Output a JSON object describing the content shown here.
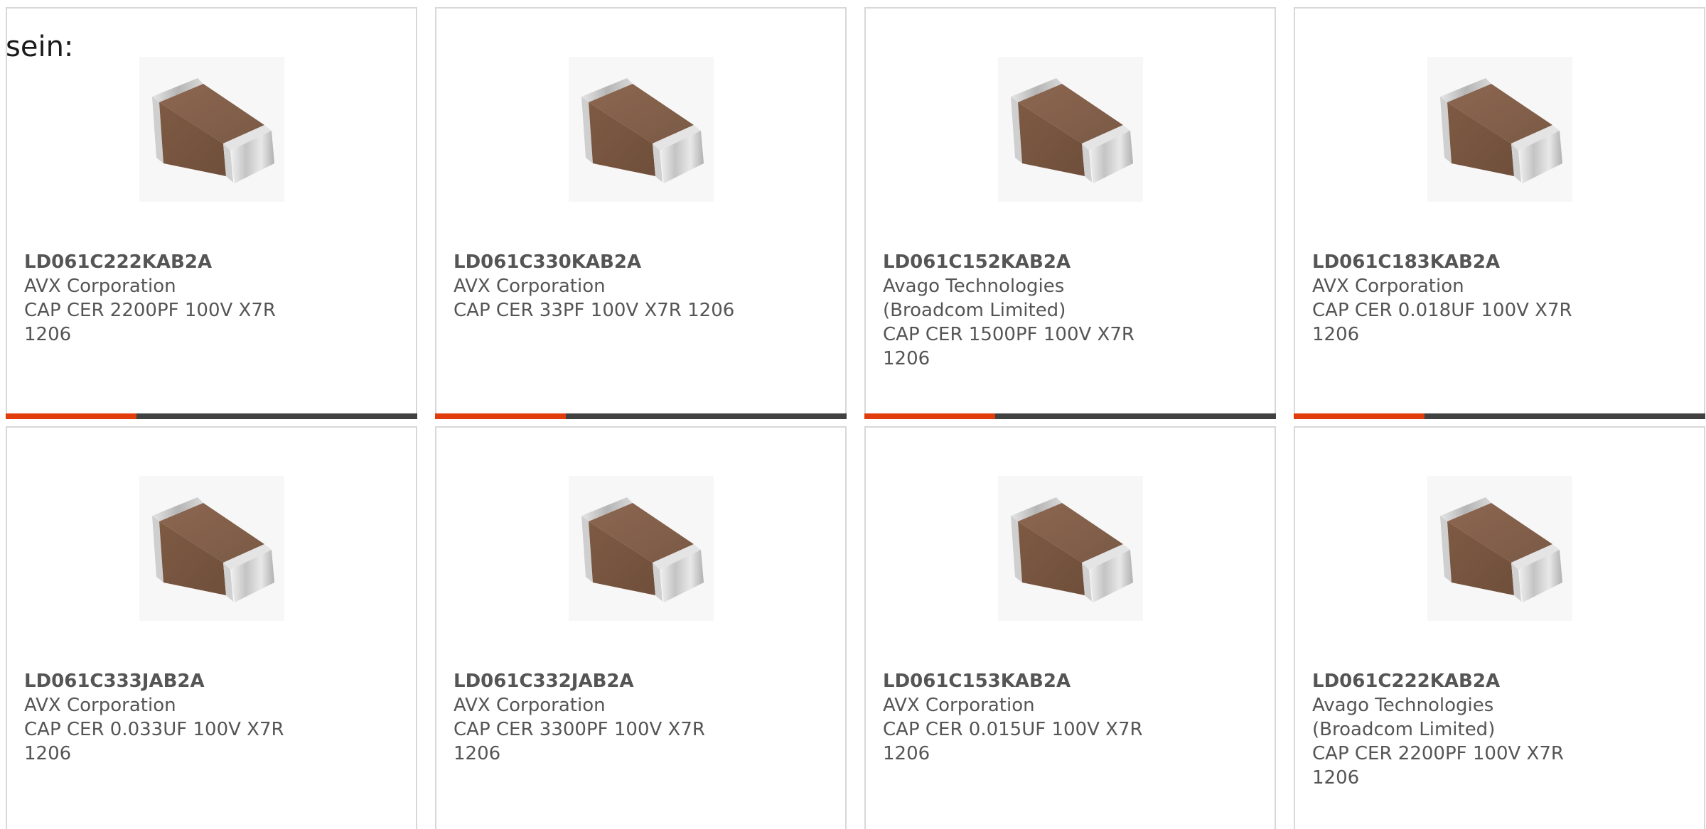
{
  "intro_text": "sein:",
  "colors": {
    "accent_bar": "#e03c0c",
    "dark_bar": "#414141",
    "text": "#555555",
    "card_border": "#d8d8d8"
  },
  "thumbnail_icon": "ceramic-capacitor-chip-icon",
  "products": [
    {
      "part_number": "LD061C222KAB2A",
      "manufacturer": "AVX Corporation",
      "description": "CAP CER 2200PF 100V X7R 1206"
    },
    {
      "part_number": "LD061C330KAB2A",
      "manufacturer": "AVX Corporation",
      "description": "CAP CER 33PF 100V X7R 1206"
    },
    {
      "part_number": "LD061C152KAB2A",
      "manufacturer": "Avago Technologies (Broadcom Limited)",
      "description": "CAP CER 1500PF 100V X7R 1206"
    },
    {
      "part_number": "LD061C183KAB2A",
      "manufacturer": "AVX Corporation",
      "description": "CAP CER 0.018UF 100V X7R 1206"
    },
    {
      "part_number": "LD061C333JAB2A",
      "manufacturer": "AVX Corporation",
      "description": "CAP CER 0.033UF 100V X7R 1206"
    },
    {
      "part_number": "LD061C332JAB2A",
      "manufacturer": "AVX Corporation",
      "description": "CAP CER 3300PF 100V X7R 1206"
    },
    {
      "part_number": "LD061C153KAB2A",
      "manufacturer": "AVX Corporation",
      "description": "CAP CER 0.015UF 100V X7R 1206"
    },
    {
      "part_number": "LD061C222KAB2A",
      "manufacturer": "Avago Technologies (Broadcom Limited)",
      "description": "CAP CER 2200PF 100V X7R 1206"
    }
  ]
}
